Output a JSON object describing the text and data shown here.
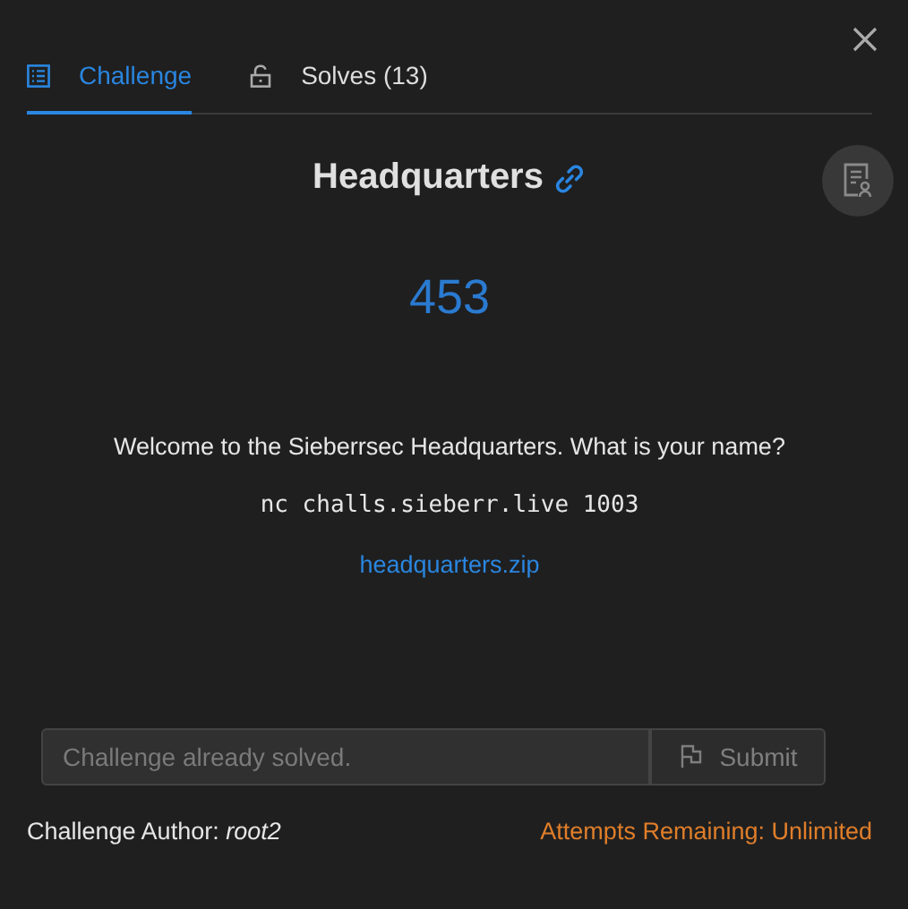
{
  "tabs": [
    {
      "label": "Challenge",
      "kind": "list",
      "selected": true
    },
    {
      "label": "Solves (13)",
      "kind": "lock",
      "selected": false
    }
  ],
  "challenge": {
    "name": "Headquarters",
    "points": "453",
    "description": "Welcome to the Sieberrsec Headquarters. What is your name?",
    "connection": "nc challs.sieberr.live 1003",
    "files": [
      "headquarters.zip"
    ]
  },
  "flag_input": {
    "placeholder": "Challenge already solved.",
    "disabled": true
  },
  "submit_button": {
    "label": "Submit",
    "disabled": true
  },
  "author": "Challenge Author: *root2*",
  "attempts": "Attempts Remaining: Unlimited"
}
